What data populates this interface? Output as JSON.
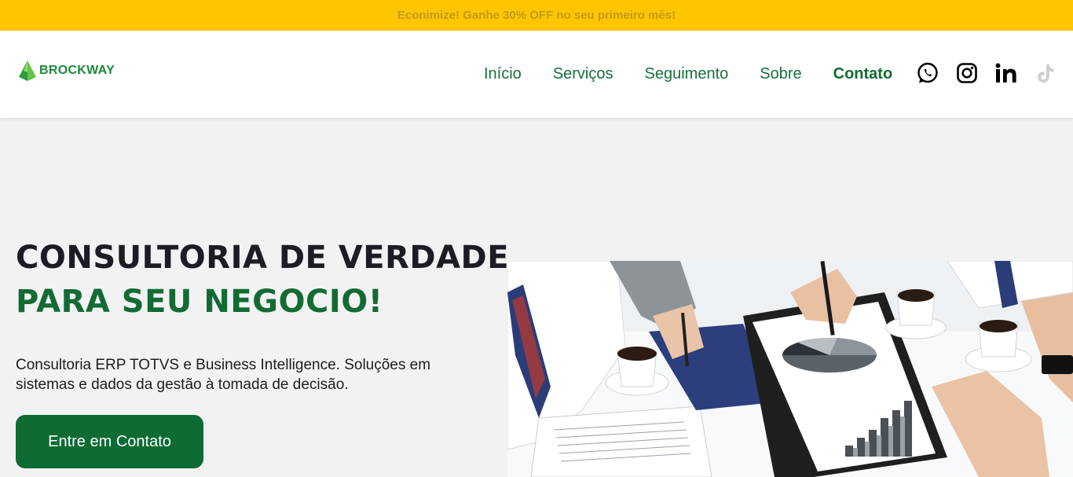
{
  "promo": {
    "text": "Econimize! Ganhe 30% OFF no seu primeiro mês!"
  },
  "header": {
    "logo_text": "BROCKWAY",
    "nav": [
      {
        "label": "Início"
      },
      {
        "label": "Serviços"
      },
      {
        "label": "Seguimento"
      },
      {
        "label": "Sobre"
      },
      {
        "label": "Contato",
        "active": true
      }
    ],
    "social": [
      "whatsapp-icon",
      "instagram-icon",
      "linkedin-icon",
      "tiktok-icon"
    ]
  },
  "hero": {
    "title_line1": "CONSULTORIA DE VERDADE",
    "title_line2": "PARA SEU NEGOCIO!",
    "description": "Consultoria ERP TOTVS e Business Intelligence. Soluções em sistemas e dados da gestão à tomada de decisão.",
    "cta_label": "Entre em Contato",
    "image_icon": "business-meeting-photo"
  },
  "colors": {
    "promo_bg": "#ffc600",
    "brand_green": "#0d6b33",
    "nav_green": "#18703a",
    "title_dark": "#1c1c24"
  }
}
